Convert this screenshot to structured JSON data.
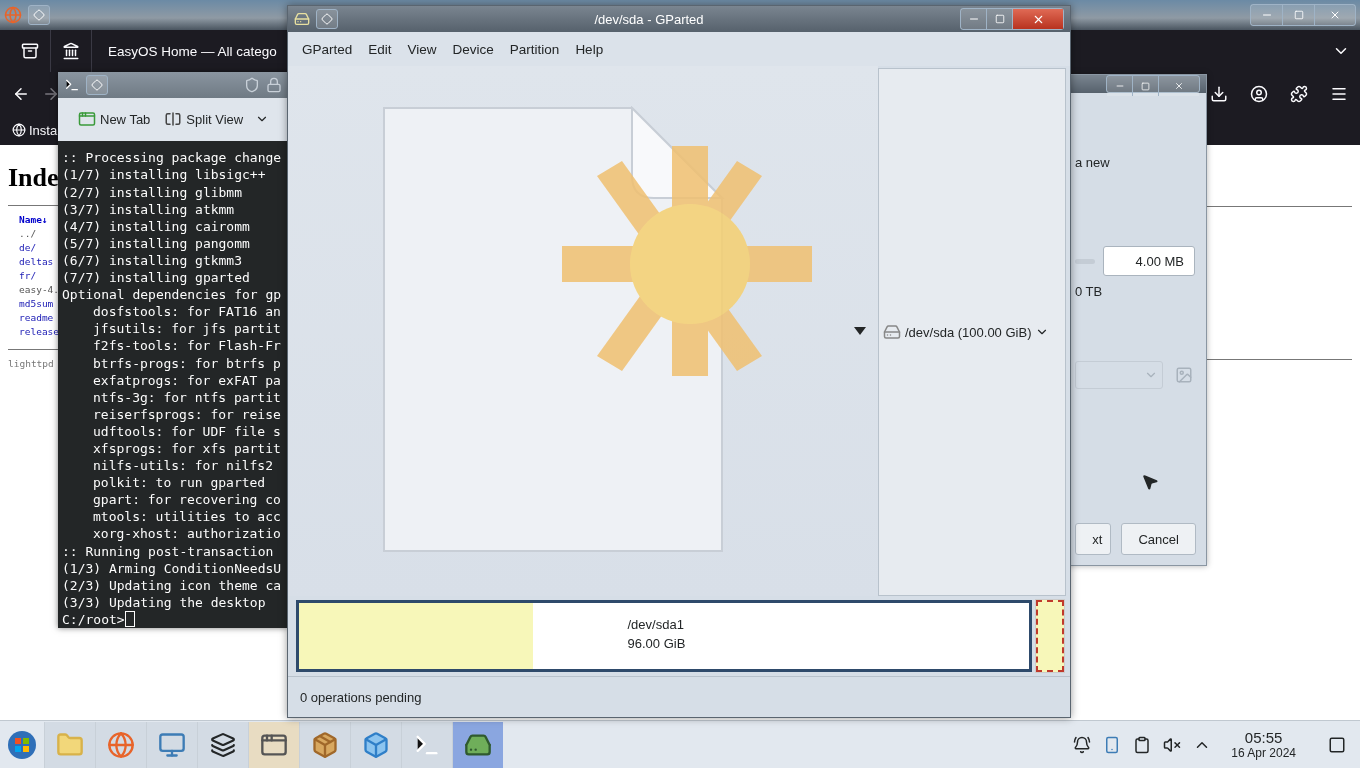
{
  "firefox": {
    "tab_title": "EasyOS Home — All catego",
    "bookmark": "Insta",
    "page": {
      "heading": "Inde",
      "column_header": "Name↓",
      "entries": [
        {
          "text": "../",
          "kind": "plain"
        },
        {
          "text": "de/",
          "kind": "link"
        },
        {
          "text": "deltas",
          "kind": "link"
        },
        {
          "text": "fr/",
          "kind": "link"
        },
        {
          "text": "easy-4.",
          "kind": "plain"
        },
        {
          "text": "md5sum",
          "kind": "link"
        },
        {
          "text": "readme",
          "kind": "link"
        },
        {
          "text": "release",
          "kind": "link"
        }
      ],
      "footer": "lighttpd"
    }
  },
  "terminal": {
    "toolbar": [
      "New Tab",
      "Split View"
    ],
    "lines": [
      {
        "text": ":: Processing package change"
      },
      {
        "text": "(1/7) installing libsigc++"
      },
      {
        "text": "(2/7) installing glibmm"
      },
      {
        "text": "(3/7) installing atkmm"
      },
      {
        "text": "(4/7) installing cairomm"
      },
      {
        "text": "(5/7) installing pangomm"
      },
      {
        "text": "(6/7) installing gtkmm3"
      },
      {
        "text": "(7/7) installing gparted"
      },
      {
        "text": "Optional dependencies for gp",
        "children": [
          {
            "text": "dosfstools: for FAT16 an"
          },
          {
            "text": "jfsutils: for jfs partit"
          },
          {
            "text": "f2fs-tools: for Flash-Fr"
          },
          {
            "text": "btrfs-progs: for btrfs p"
          },
          {
            "text": "exfatprogs: for exFAT pa"
          },
          {
            "text": "ntfs-3g: for ntfs partit"
          },
          {
            "text": "reiserfsprogs: for reise"
          },
          {
            "text": "udftools: for UDF file s"
          },
          {
            "text": "xfsprogs: for xfs partit"
          },
          {
            "text": "nilfs-utils: for nilfs2"
          },
          {
            "text": "polkit: to run gparted"
          },
          {
            "text": "gpart: for recovering co"
          },
          {
            "text": "mtools: utilities to acc"
          },
          {
            "text": "xorg-xhost: authorizatio"
          }
        ]
      },
      {
        "text": ":: Running post-transaction"
      },
      {
        "text": "(1/3) Arming ConditionNeedsU"
      },
      {
        "text": "(2/3) Updating icon theme ca"
      },
      {
        "text": "(3/3) Updating the desktop"
      }
    ],
    "prompt": "C:/root>"
  },
  "gparted": {
    "title": "/dev/sda - GParted",
    "menu": [
      "GParted",
      "Edit",
      "View",
      "Device",
      "Partition",
      "Help"
    ],
    "device": "/dev/sda (100.00 GiB)",
    "partition": {
      "name": "/dev/sda1",
      "size": "96.00 GiB",
      "level": 0.32
    },
    "status": "0 operations pending"
  },
  "dialog": {
    "text": "a new",
    "size_value": "4.00 MB",
    "max_text": "0 TB",
    "buttons": [
      "xt",
      "Cancel"
    ]
  },
  "taskbar": {
    "apps": [
      {
        "kind": "folder",
        "selected": false
      },
      {
        "kind": "browser",
        "selected": false
      },
      {
        "kind": "monitor",
        "selected": false
      },
      {
        "kind": "windows",
        "selected": false
      },
      {
        "kind": "window",
        "selected": true
      },
      {
        "kind": "package",
        "selected": false
      },
      {
        "kind": "cube",
        "selected": false
      },
      {
        "kind": "terminal",
        "selected": false
      },
      {
        "kind": "disk",
        "selected": true
      }
    ],
    "time": "05:55",
    "date": "16 Apr 2024"
  }
}
